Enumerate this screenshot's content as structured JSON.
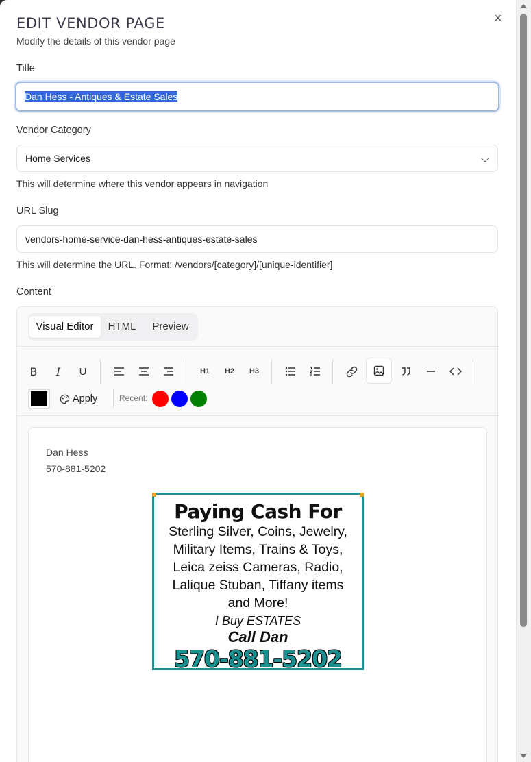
{
  "modal": {
    "title": "EDIT VENDOR PAGE",
    "subtitle": "Modify the details of this vendor page",
    "close_glyph": "×"
  },
  "fields": {
    "title_label": "Title",
    "title_value": "Dan Hess - Antiques & Estate Sales",
    "category_label": "Vendor Category",
    "category_value": "Home Services",
    "category_help": "This will determine where this vendor appears in navigation",
    "slug_label": "URL Slug",
    "slug_value": "vendors-home-service-dan-hess-antiques-estate-sales",
    "slug_help": "This will determine the URL. Format: /vendors/[category]/[unique-identifier]",
    "content_label": "Content"
  },
  "editor": {
    "tabs": [
      "Visual Editor",
      "HTML",
      "Preview"
    ],
    "active_tab": "Visual Editor",
    "toolbar": {
      "bold": "B",
      "italic": "I",
      "underline": "U",
      "h1": "H1",
      "h2": "H2",
      "h3": "H3",
      "apply_label": "Apply",
      "recent_label": "Recent:",
      "current_color": "#000000",
      "recent_colors": [
        "#ff0000",
        "#0000ff",
        "#008000"
      ]
    },
    "content": {
      "line1": "Dan Hess",
      "line2": "570-881-5202",
      "ad": {
        "headline": "Paying Cash For",
        "items": [
          "Sterling Silver, Coins, Jewelry,",
          "Military Items, Trains & Toys,",
          "Leica zeiss Cameras, Radio,",
          "Lalique Stuban, Tiffany items",
          "and More!"
        ],
        "estates": "I Buy ESTATES",
        "call": "Call Dan",
        "phone": "570-881-5202"
      }
    }
  },
  "colors": {
    "accent_border": "#9fb9de",
    "selection": "#3367d6",
    "ad_teal": "#1a9090"
  }
}
